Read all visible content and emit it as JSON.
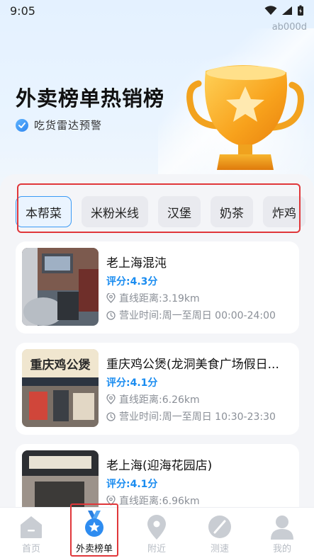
{
  "status_bar": {
    "time": "9:05",
    "device_id": "ab000d"
  },
  "hero": {
    "title": "外卖榜单热销榜",
    "subtitle": "吃货雷达预警"
  },
  "categories": [
    {
      "label": "本帮菜",
      "active": true
    },
    {
      "label": "米粉米线",
      "active": false
    },
    {
      "label": "汉堡",
      "active": false
    },
    {
      "label": "奶茶",
      "active": false
    },
    {
      "label": "炸鸡",
      "active": false
    }
  ],
  "shops": [
    {
      "name": "老上海混沌",
      "score": "评分:4.3分",
      "distance": "直线距离:3.19km",
      "hours": "营业时间:周一至周日 00:00-24:00"
    },
    {
      "name": "重庆鸡公煲(龙洞美食广场假日...",
      "score": "评分:4.1分",
      "distance": "直线距离:6.26km",
      "hours": "营业时间:周一至周日 10:30-23:30",
      "sign_text": "重庆鸡公煲"
    },
    {
      "name": "老上海(迎海花园店)",
      "score": "评分:4.1分",
      "distance": "直线距离:6.96km",
      "hours": ""
    }
  ],
  "tabbar": {
    "items": [
      {
        "label": "首页",
        "icon": "home-icon"
      },
      {
        "label": "外卖榜单",
        "icon": "medal-icon",
        "active": true
      },
      {
        "label": "附近",
        "icon": "location-pin-icon"
      },
      {
        "label": "测速",
        "icon": "speedometer-icon"
      },
      {
        "label": "我的",
        "icon": "user-icon"
      }
    ]
  },
  "colors": {
    "accent": "#1a8cf0",
    "highlight_border": "#e0373a",
    "trophy": "#f6a21d"
  }
}
